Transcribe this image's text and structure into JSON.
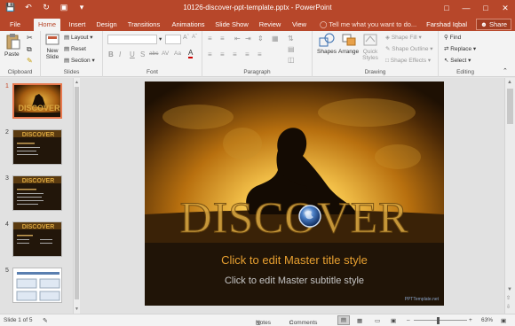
{
  "window": {
    "title": "10126-discover-ppt-template.pptx - PowerPoint",
    "qat": [
      "save-icon",
      "undo-icon",
      "redo-icon",
      "start-from-beginning-icon",
      "customize-icon"
    ]
  },
  "tabs": [
    {
      "label": "File"
    },
    {
      "label": "Home",
      "active": true
    },
    {
      "label": "Insert"
    },
    {
      "label": "Design"
    },
    {
      "label": "Transitions"
    },
    {
      "label": "Animations"
    },
    {
      "label": "Slide Show"
    },
    {
      "label": "Review"
    },
    {
      "label": "View"
    }
  ],
  "tell_me": "Tell me what you want to do...",
  "user": "Farshad Iqbal",
  "share": "Share",
  "ribbon": {
    "clipboard": {
      "label": "Clipboard",
      "paste": "Paste"
    },
    "slides": {
      "label": "Slides",
      "new_slide": "New",
      "new_slide2": "Slide",
      "layout": "Layout",
      "reset": "Reset",
      "section": "Section"
    },
    "font": {
      "label": "Font",
      "bold": "B",
      "italic": "I",
      "underline": "U",
      "shadow": "S",
      "strike": "abc",
      "spacing": "AV",
      "case": "Aa",
      "color": "A"
    },
    "paragraph": {
      "label": "Paragraph"
    },
    "drawing": {
      "label": "Drawing",
      "shapes": "Shapes",
      "arrange": "Arrange",
      "quick_styles": "Quick",
      "quick_styles2": "Styles",
      "shape_fill": "Shape Fill",
      "shape_outline": "Shape Outline",
      "shape_effects": "Shape Effects"
    },
    "editing": {
      "label": "Editing",
      "find": "Find",
      "replace": "Replace",
      "select": "Select"
    }
  },
  "thumbnails": [
    {
      "num": "1",
      "active": true
    },
    {
      "num": "2"
    },
    {
      "num": "3"
    },
    {
      "num": "4"
    },
    {
      "num": "5"
    }
  ],
  "slide": {
    "heading": "DISCOVER",
    "title_placeholder": "Click to edit Master title style",
    "subtitle_placeholder": "Click to edit Master subtitle style",
    "watermark": "PPTTemplate.net"
  },
  "status": {
    "slide_info": "Slide 1 of 5",
    "notes": "Notes",
    "comments": "Comments",
    "zoom": "63%"
  },
  "colors": {
    "accent": "#b7472a",
    "title_text": "#e8a030",
    "slide_heading": "#d9a640"
  }
}
